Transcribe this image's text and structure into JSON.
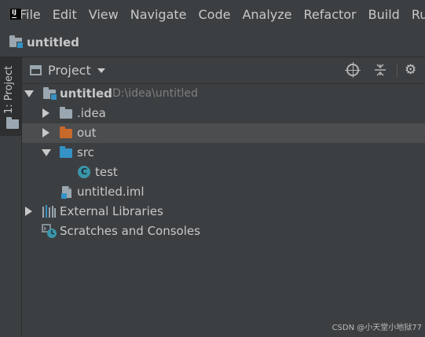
{
  "menubar": {
    "logo_text": "IJ",
    "items": [
      "File",
      "Edit",
      "View",
      "Navigate",
      "Code",
      "Analyze",
      "Refactor",
      "Build",
      "Ru"
    ]
  },
  "titlebar": {
    "title": "untitled"
  },
  "sidebar": {
    "tab_label": "1: Project"
  },
  "panel": {
    "selector_label": "Project"
  },
  "tree": {
    "root": {
      "label": "untitled",
      "path": "D:\\idea\\untitled"
    },
    "idea": ".idea",
    "out": "out",
    "src": "src",
    "test_class": "test",
    "class_badge": "C",
    "iml": "untitled.iml",
    "external": "External Libraries",
    "scratches": "Scratches and Consoles"
  },
  "watermark": "CSDN @小天堂小地狱77",
  "colors": {
    "background": "#3c3f41",
    "folder_grey": "#9aa7b0",
    "folder_orange": "#c7692b",
    "folder_blue": "#3592c4",
    "selected_row": "#4b4d4f"
  }
}
